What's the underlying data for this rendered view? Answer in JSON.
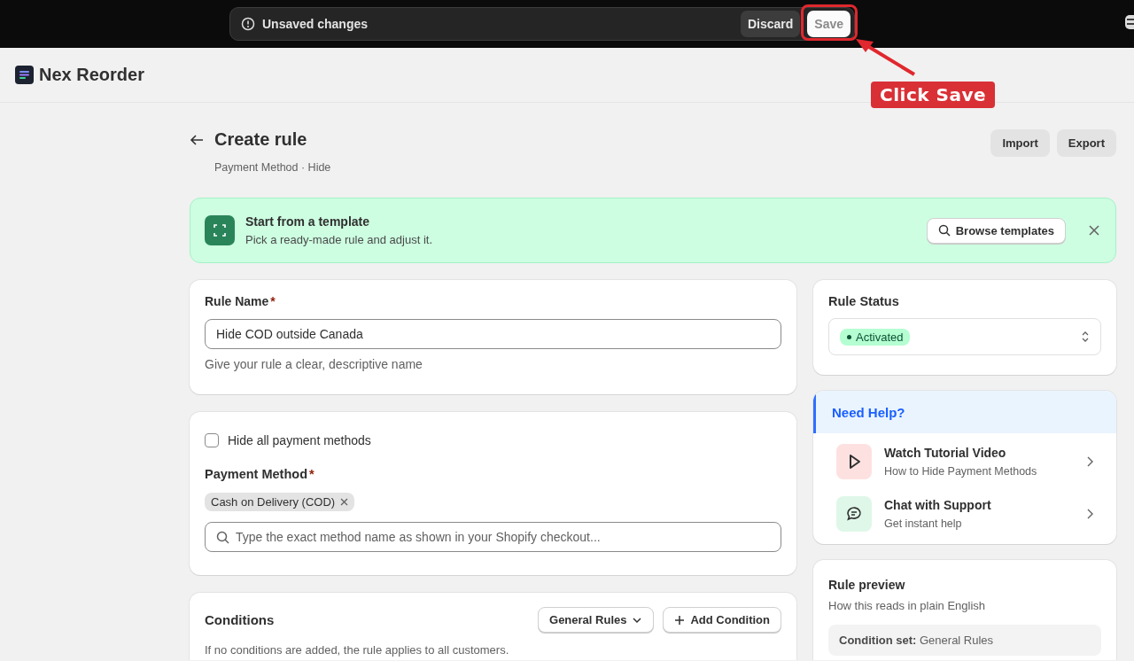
{
  "save_bar": {
    "message": "Unsaved changes",
    "buttons": [
      {
        "label": "Discard",
        "kind": "secondary"
      },
      {
        "label": "Save",
        "kind": "primary"
      }
    ]
  },
  "annotation": {
    "text": "Click Save"
  },
  "app": {
    "name": "Nex Reorder"
  },
  "page": {
    "title": "Create rule",
    "subtitle": "Payment Method · Hide",
    "actions": [
      "Import",
      "Export"
    ]
  },
  "template_banner": {
    "title": "Start from a template",
    "description": "Pick a ready-made rule and adjust it.",
    "button": "Browse templates"
  },
  "rule_name": {
    "label": "Rule Name",
    "required_mark": "*",
    "value": "Hide COD outside Canada",
    "help": "Give your rule a clear, descriptive name"
  },
  "payment": {
    "hide_all": {
      "label": "Hide all payment methods",
      "checked": false
    },
    "label": "Payment Method",
    "required_mark": "*",
    "tags": [
      "Cash on Delivery (COD)"
    ],
    "search_placeholder": "Type the exact method name as shown in your Shopify checkout..."
  },
  "conditions": {
    "title": "Conditions",
    "dropdown": "General Rules",
    "add_button": "Add Condition",
    "note": "If no conditions are added, the rule applies to all customers."
  },
  "rule_status": {
    "title": "Rule Status",
    "value": "Activated"
  },
  "help": {
    "title": "Need Help?",
    "items": [
      {
        "kind": "video",
        "title": "Watch Tutorial Video",
        "subtitle": "How to Hide Payment Methods"
      },
      {
        "kind": "chat",
        "title": "Chat with Support",
        "subtitle": "Get instant help"
      }
    ]
  },
  "preview": {
    "title": "Rule preview",
    "subtitle": "How this reads in plain English",
    "lines": [
      "**Condition set:** General Rules"
    ]
  }
}
